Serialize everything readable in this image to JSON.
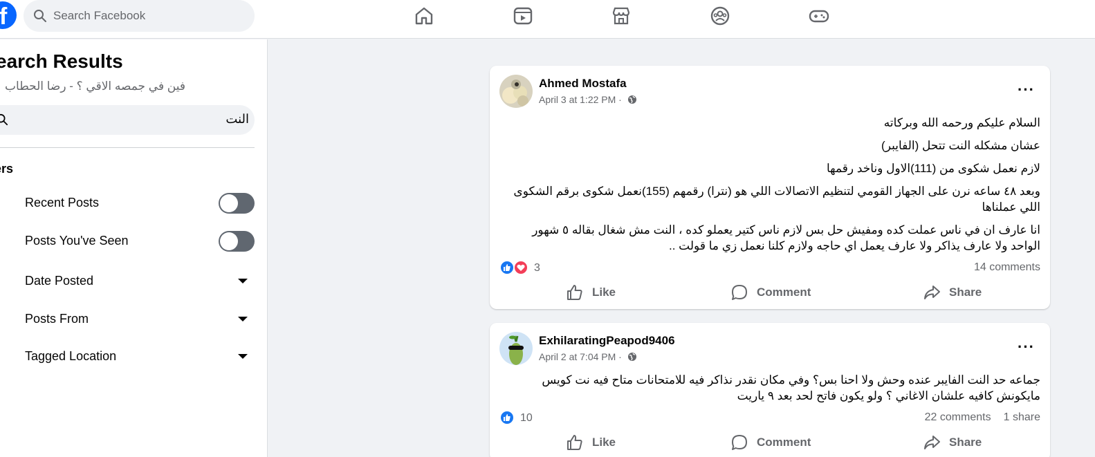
{
  "topbar": {
    "search_placeholder": "Search Facebook",
    "nav_icons": [
      "home-icon",
      "video-icon",
      "marketplace-icon",
      "groups-icon",
      "gaming-icon"
    ]
  },
  "left_panel": {
    "title": "earch Results",
    "subtitle": "فين في جمصه الاقي ؟ - رضا الحطاب",
    "search_value": "النت",
    "filters_label": "ters",
    "filters": [
      {
        "label": "Recent Posts",
        "control": "toggle",
        "on": false
      },
      {
        "label": "Posts You've Seen",
        "control": "toggle",
        "on": false
      },
      {
        "label": "Date Posted",
        "control": "dropdown"
      },
      {
        "label": "Posts From",
        "control": "dropdown"
      },
      {
        "label": "Tagged Location",
        "control": "dropdown"
      }
    ]
  },
  "posts": [
    {
      "author": "Ahmed Mostafa",
      "time": "April 3 at 1:22 PM · ",
      "paragraphs": [
        "السلام عليكم ورحمه الله وبركاته",
        "عشان مشكله النت تتحل (الفايبر)",
        "لازم نعمل شكوى من (111)الاول وناخد رقمها",
        "وبعد ٤٨ ساعه نرن على الجهاز القومي لتنظيم الاتصالات اللي هو (نترا)  رقمهم (155)نعمل شكوى برقم الشكوى اللي عملناها",
        "انا عارف ان في ناس عملت كده ومفيش حل بس لازم ناس كتير يعملو كده ، النت مش شغال بقاله ٥ شهور الواحد ولا عارف يذاكر ولا عارف يعمل اي حاجه ولازم كلنا نعمل زي ما قولت .."
      ],
      "reactions": [
        "like",
        "love"
      ],
      "reaction_count": "3",
      "comments": "14 comments",
      "shares": ""
    },
    {
      "author": "ExhilaratingPeapod9406",
      "time": "April 2 at 7:04 PM · ",
      "paragraphs": [
        "جماعه حد النت الفايبر عنده وحش ولا احنا بس؟ وفي مكان نقدر نذاكر فيه للامتحانات متاح فيه نت كويس مايكونش كافيه علشان الاغاني ؟ ولو يكون فاتح لحد بعد ٩ ياريت"
      ],
      "reactions": [
        "like"
      ],
      "reaction_count": "10",
      "comments": "22 comments",
      "shares": "1 share"
    }
  ],
  "actions": {
    "like": "Like",
    "comment": "Comment",
    "share": "Share"
  },
  "colors": {
    "brand": "#0866ff",
    "like": "#1877f2",
    "love": "#f33e58"
  }
}
